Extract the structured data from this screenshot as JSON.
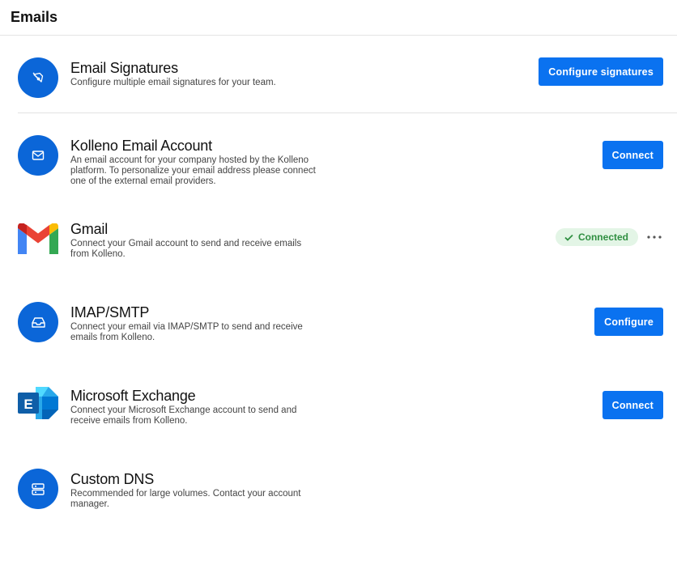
{
  "header": {
    "title": "Emails"
  },
  "items": [
    {
      "title": "Email Signatures",
      "desc": "Configure multiple email signatures for your team.",
      "icon": "pen-nib-icon",
      "action_label": "Configure signatures"
    },
    {
      "title": "Kolleno Email Account",
      "desc": "An email account for your company hosted by the Kolleno platform. To personalize your email address please connect one of the external email providers.",
      "icon": "envelope-icon",
      "action_label": "Connect"
    },
    {
      "title": "Gmail",
      "desc": "Connect your Gmail account to send and receive emails from Kolleno.",
      "icon": "gmail-logo-icon",
      "status": "Connected"
    },
    {
      "title": "IMAP/SMTP",
      "desc": "Connect your email via IMAP/SMTP to send and receive emails from Kolleno.",
      "icon": "inbox-tray-icon",
      "action_label": "Configure"
    },
    {
      "title": "Microsoft Exchange",
      "desc": "Connect your Microsoft Exchange account to send and receive emails from Kolleno.",
      "icon": "exchange-logo-icon",
      "action_label": "Connect"
    },
    {
      "title": "Custom DNS",
      "desc": "Recommended for large volumes. Contact your account manager.",
      "icon": "server-icon"
    }
  ],
  "colors": {
    "primary": "#0a72f0",
    "icon_circle": "#0b66d8",
    "connected_bg": "#e3f5e6",
    "connected_text": "#2f8f41"
  }
}
